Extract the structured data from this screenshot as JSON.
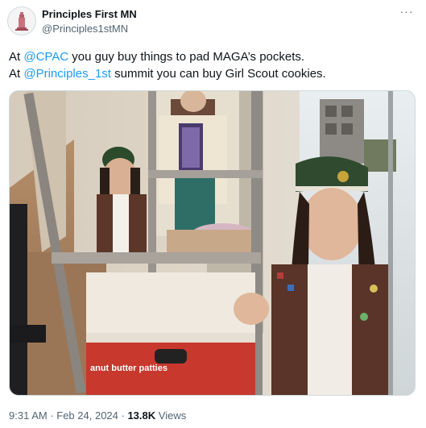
{
  "author": {
    "display_name": "Principles First MN",
    "handle": "@Principles1stMN",
    "avatar_icon": "monument-icon"
  },
  "more_icon": "more-horizontal-icon",
  "tweet": {
    "line1": {
      "pre": "At ",
      "mention": "@CPAC",
      "post": " you guy buy things to pad MAGA’s pockets."
    },
    "line2": {
      "pre": "At ",
      "mention": "@Principles_1st",
      "post": " summit you can buy Girl Scout cookies."
    }
  },
  "media": {
    "box_label": "anut butter patties"
  },
  "meta": {
    "time": "9:31 AM",
    "date": "Feb 24, 2024",
    "views_count": "13.8K",
    "views_label": "Views"
  },
  "colors": {
    "link": "#1d9bf0",
    "secondary": "#536471",
    "primary": "#0f1419"
  }
}
